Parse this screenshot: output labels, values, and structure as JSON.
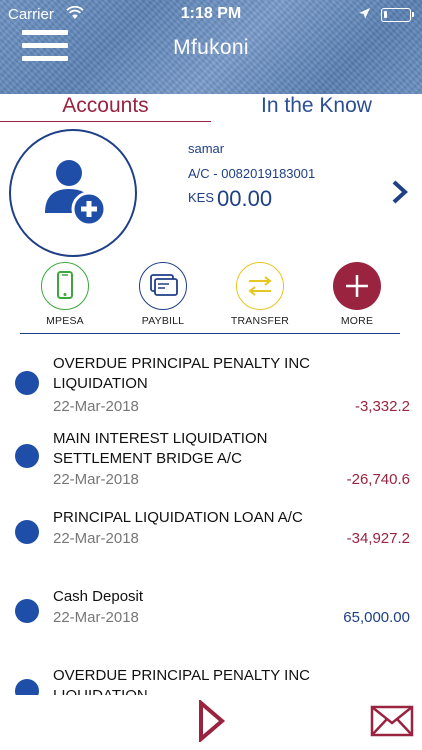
{
  "status_bar": {
    "carrier": "Carrier",
    "time": "1:18 PM"
  },
  "header": {
    "title": "Mfukoni",
    "menu_icon": "hamburger-menu-icon"
  },
  "tabs": [
    {
      "label": "Accounts",
      "active": true
    },
    {
      "label": "In the Know",
      "active": false
    }
  ],
  "account": {
    "name": "samar",
    "number": "A/C - 0082019183001",
    "currency": "KES",
    "balance": "00.00",
    "avatar_icon": "add-user-icon"
  },
  "actions": [
    {
      "label": "MPESA",
      "icon": "phone-icon",
      "color": "#3ca83c"
    },
    {
      "label": "PAYBILL",
      "icon": "bill-icon",
      "color": "#1f3f86"
    },
    {
      "label": "TRANSFER",
      "icon": "transfer-arrows-icon",
      "color": "#e8c521"
    },
    {
      "label": "MORE",
      "icon": "plus-icon",
      "color": "#9a2340"
    }
  ],
  "transactions": [
    {
      "description": "OVERDUE PRINCIPAL PENALTY INC LIQUIDATION",
      "date": "22-Mar-2018",
      "amount": "-3,332.2",
      "type": "debit"
    },
    {
      "description": "MAIN INTEREST LIQUIDATION SETTLEMENT BRIDGE A/C",
      "date": "22-Mar-2018",
      "amount": "-26,740.6",
      "type": "debit"
    },
    {
      "description": "PRINCIPAL LIQUIDATION LOAN A/C",
      "date": "22-Mar-2018",
      "amount": "-34,927.2",
      "type": "debit"
    },
    {
      "description": "Cash Deposit",
      "date": "22-Mar-2018",
      "amount": "65,000.00",
      "type": "credit"
    },
    {
      "description": "OVERDUE PRINCIPAL PENALTY INC LIQUIDATION",
      "date": "",
      "amount": "",
      "type": "debit"
    }
  ],
  "colors": {
    "accent_maroon": "#9a2340",
    "accent_navy": "#1f3f86",
    "dot_blue": "#1f4ea8"
  }
}
